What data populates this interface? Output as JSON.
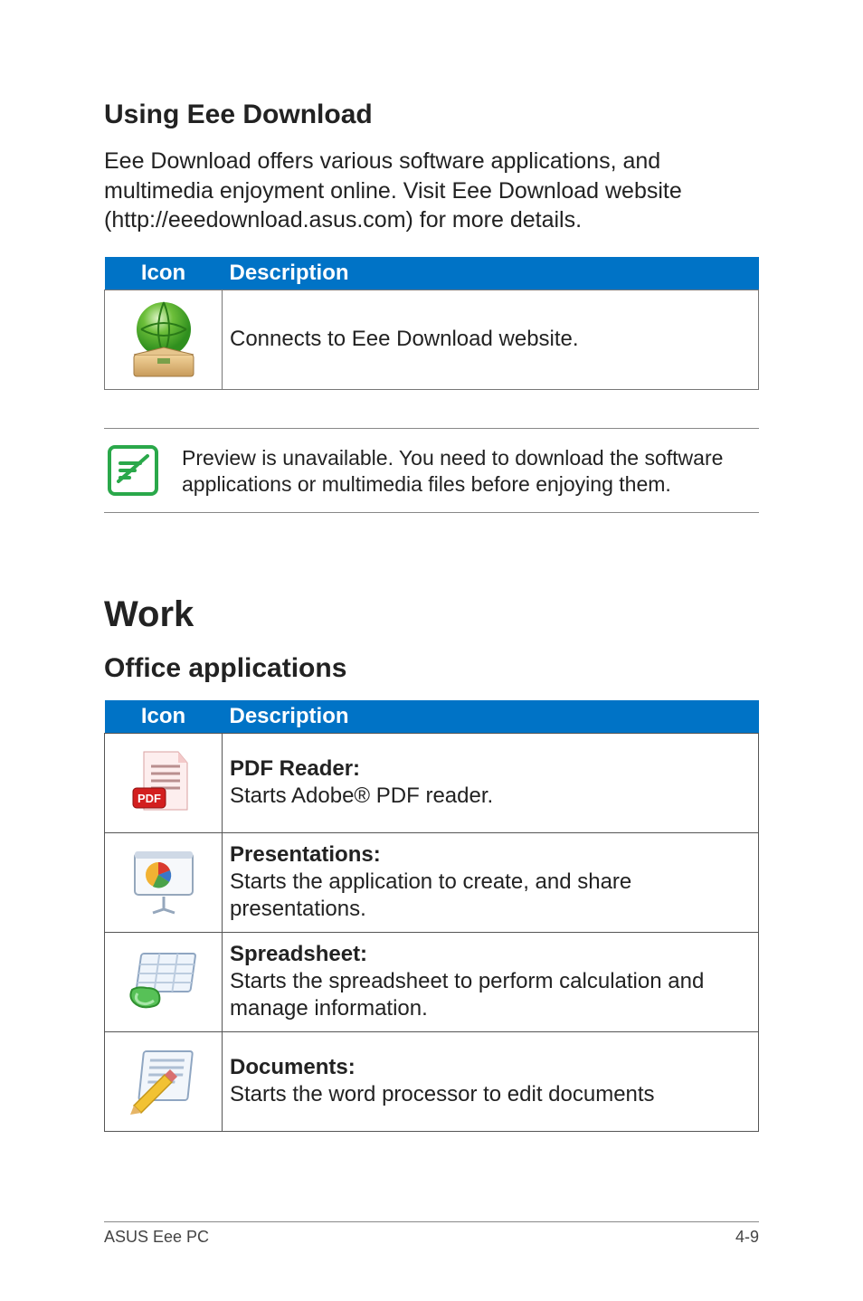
{
  "section_intro": {
    "heading": "Using Eee Download",
    "body": "Eee Download offers various software applications, and multimedia enjoyment online. Visit Eee Download website (http://eeedownload.asus.com) for more details."
  },
  "table1": {
    "headers": {
      "icon": "Icon",
      "desc": "Description"
    },
    "rows": [
      {
        "icon": "globe-box-icon",
        "desc": "Connects to Eee Download website."
      }
    ]
  },
  "note": {
    "text": "Preview is unavailable. You need to download the software applications or multimedia files before enjoying them."
  },
  "work": {
    "heading": "Work",
    "subheading": "Office applications"
  },
  "table2": {
    "headers": {
      "icon": "Icon",
      "desc": "Description"
    },
    "rows": [
      {
        "icon": "pdf-icon",
        "title": "PDF Reader:",
        "desc": "Starts Adobe® PDF reader."
      },
      {
        "icon": "presentations-icon",
        "title": "Presentations:",
        "desc": "Starts the application to create, and share presentations."
      },
      {
        "icon": "spreadsheet-icon",
        "title": "Spreadsheet:",
        "desc": "Starts the spreadsheet to perform calculation and manage information."
      },
      {
        "icon": "documents-icon",
        "title": "Documents:",
        "desc": "Starts the word processor to edit documents"
      }
    ]
  },
  "footer": {
    "left": "ASUS Eee PC",
    "right": "4-9"
  }
}
